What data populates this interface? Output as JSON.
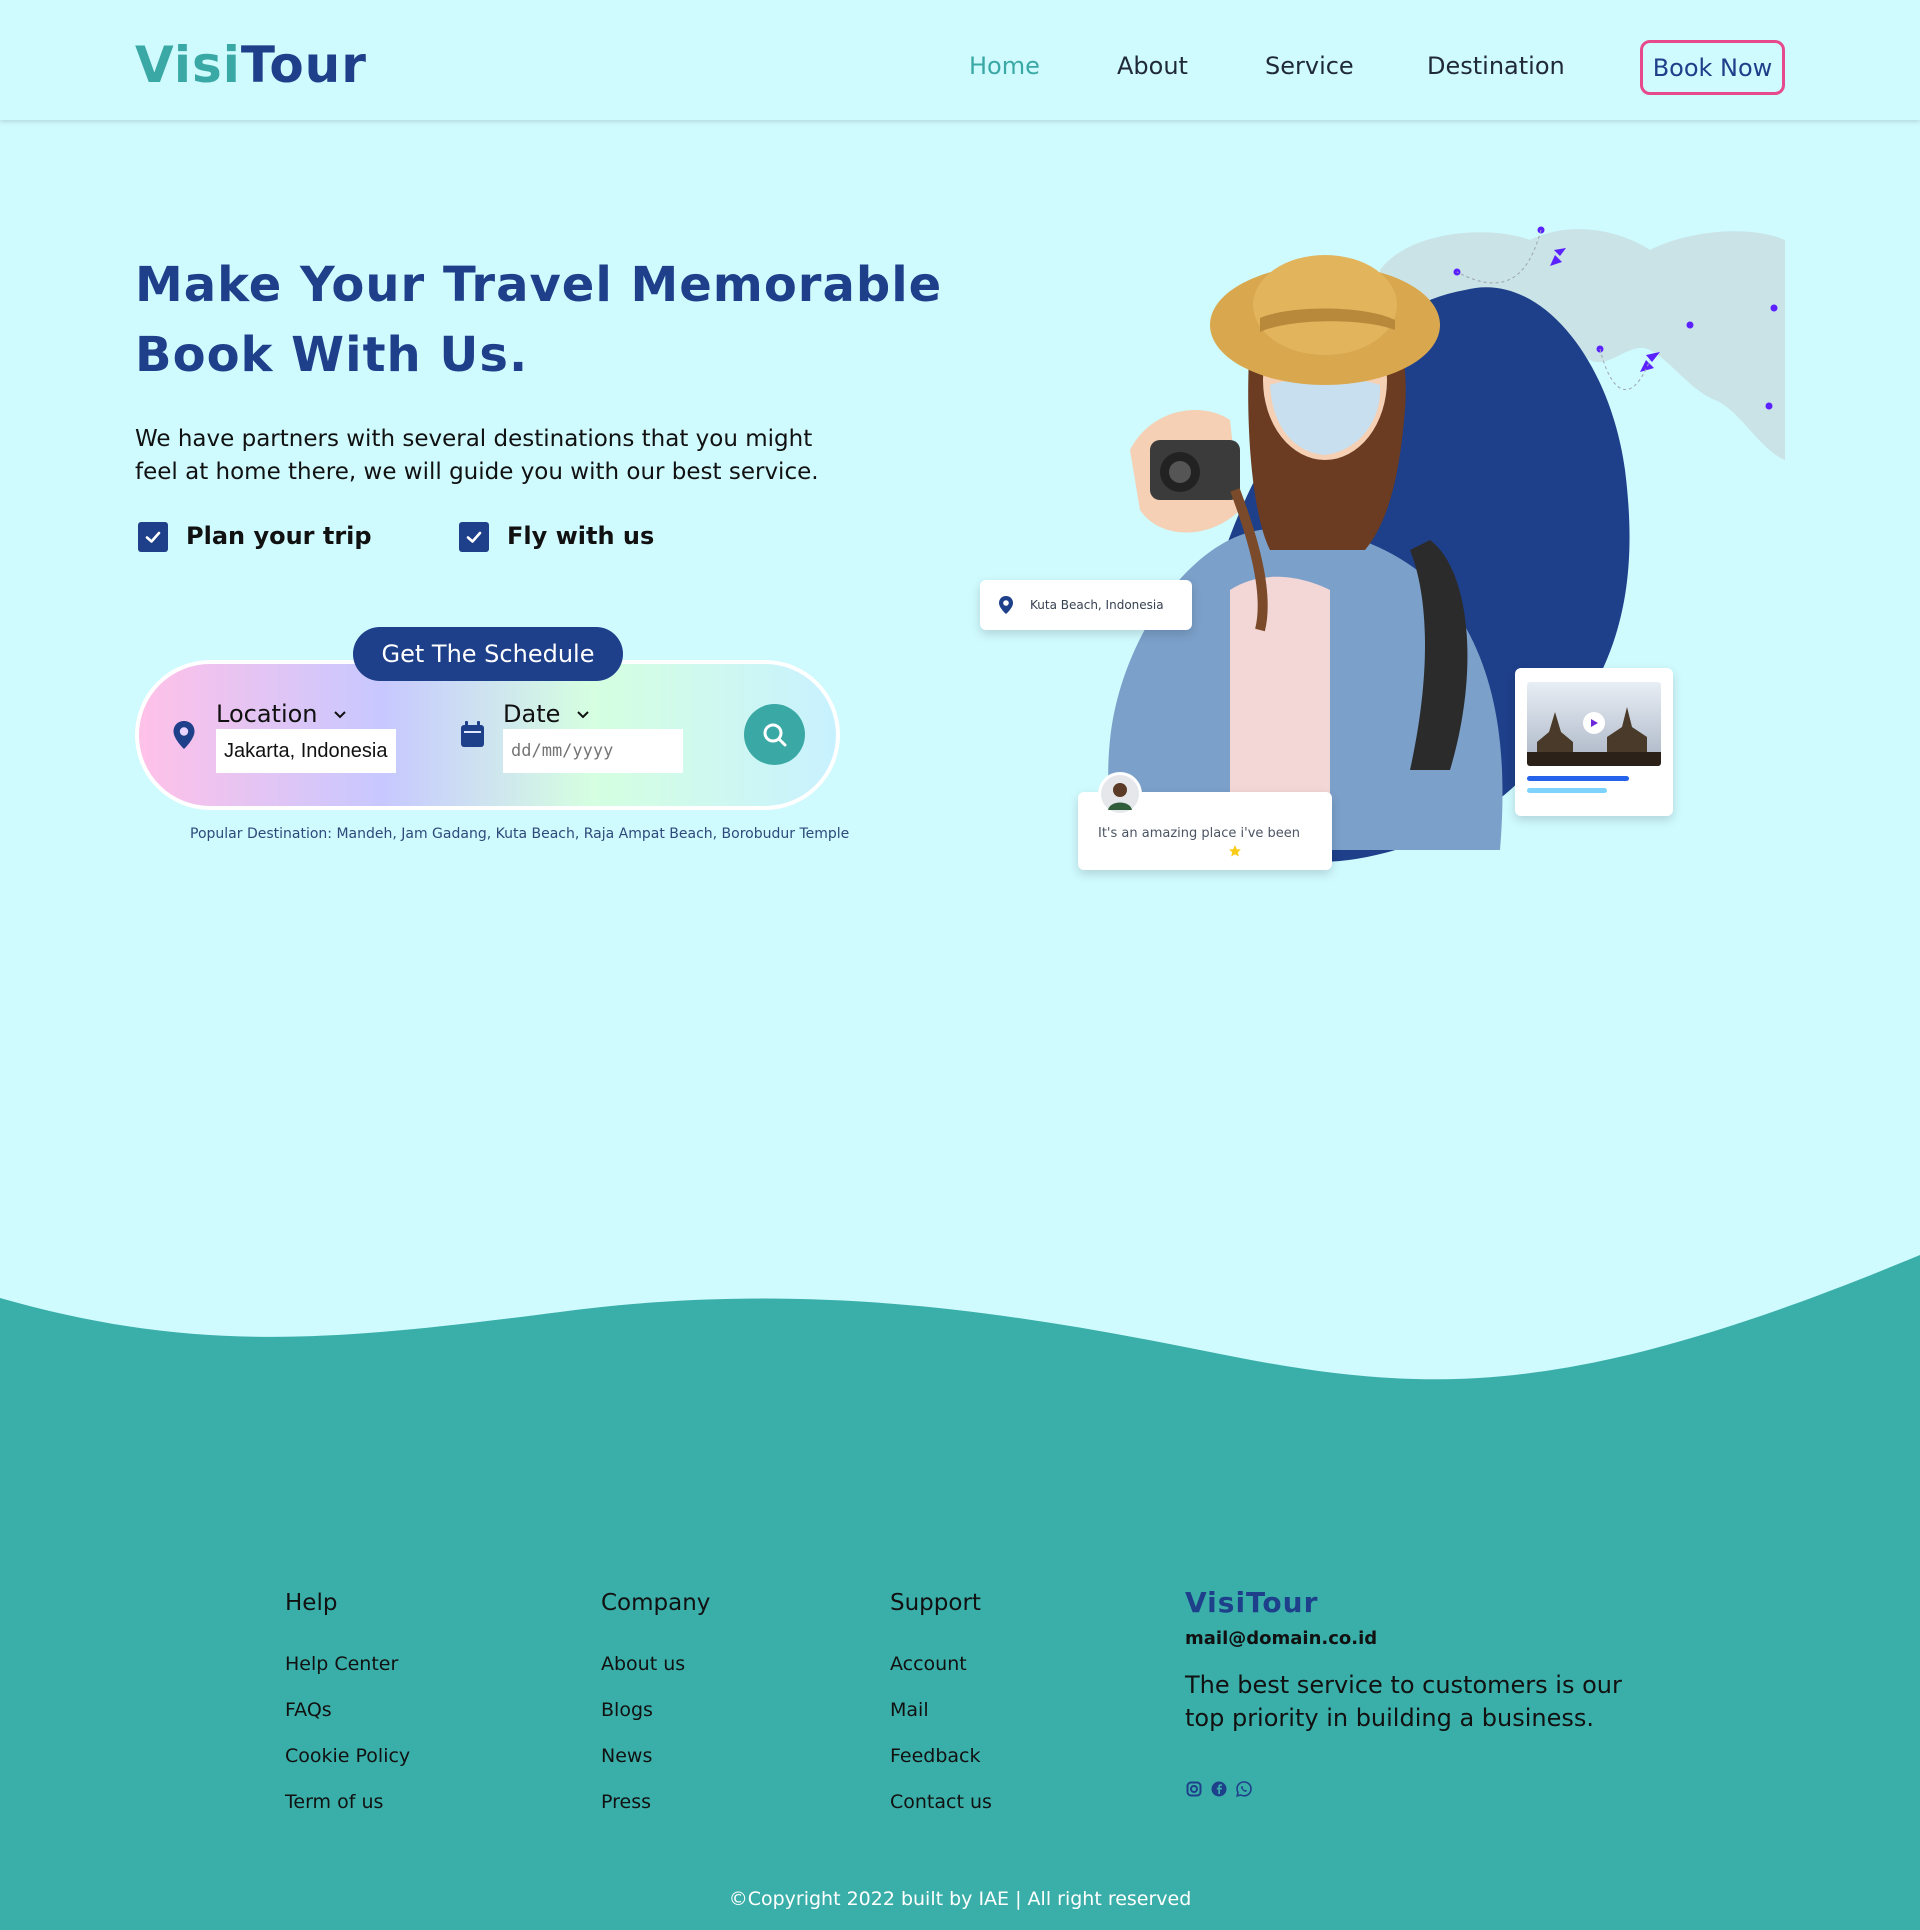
{
  "header": {
    "logo_part1": "Visi",
    "logo_part2": "Tour",
    "nav": [
      "Home",
      "About",
      "Service",
      "Destination"
    ],
    "book_now": "Book Now"
  },
  "hero": {
    "title_line1": "Make Your Travel Memorable",
    "title_line2": "Book With Us.",
    "subtitle_line1": "We have partners with several destinations that you might",
    "subtitle_line2": "feel at home there, we will guide you with our best service.",
    "check1": "Plan your trip",
    "check2": "Fly with us"
  },
  "search": {
    "schedule_button": "Get The Schedule",
    "location_label": "Location",
    "location_value": "Jakarta, Indonesia",
    "date_label": "Date",
    "date_placeholder": "dd/mm/yyyy",
    "popular": "Popular Destination: Mandeh, Jam Gadang, Kuta Beach, Raja Ampat Beach, Borobudur Temple"
  },
  "illustration": {
    "location_card": "Kuta Beach, Indonesia",
    "review_card": "It's an amazing place i've been"
  },
  "footer": {
    "help": {
      "title": "Help",
      "links": [
        "Help Center",
        "FAQs",
        "Cookie Policy",
        "Term of us"
      ]
    },
    "company": {
      "title": "Company",
      "links": [
        "About us",
        "Blogs",
        "News",
        "Press"
      ]
    },
    "support": {
      "title": "Support",
      "links": [
        "Account",
        "Mail",
        "Feedback",
        "Contact us"
      ]
    },
    "brand": "VisiTour",
    "mail": "mail@domain.co.id",
    "desc": "The best service to customers is our top priority in building a business.",
    "social_icons": [
      "instagram-icon",
      "facebook-icon",
      "whatsapp-icon"
    ],
    "copyright": "©Copyright 2022 built by IAE | All right reserved"
  },
  "colors": {
    "background": "#cffafe",
    "primary": "#1e3f8a",
    "accent": "#3aa9a6",
    "book_border": "#e64a8c"
  }
}
